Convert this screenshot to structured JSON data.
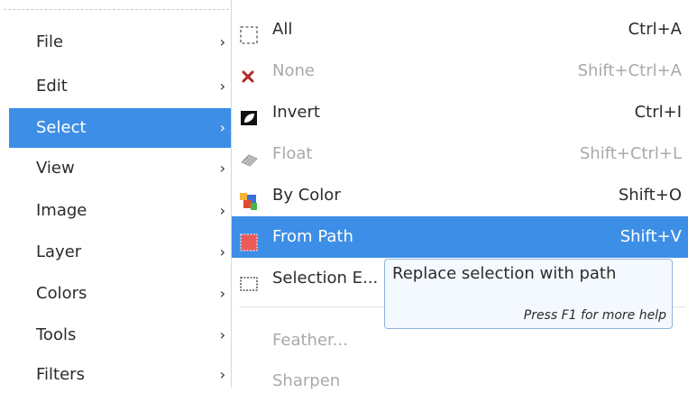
{
  "main_menu": {
    "items": [
      {
        "label": "File",
        "arrow": "›"
      },
      {
        "label": "Edit",
        "arrow": "›"
      },
      {
        "label": "Select",
        "arrow": "›"
      },
      {
        "label": "View",
        "arrow": "›"
      },
      {
        "label": "Image",
        "arrow": "›"
      },
      {
        "label": "Layer",
        "arrow": "›"
      },
      {
        "label": "Colors",
        "arrow": "›"
      },
      {
        "label": "Tools",
        "arrow": "›"
      },
      {
        "label": "Filters",
        "arrow": "›"
      }
    ],
    "active_item": "Select"
  },
  "select_submenu": {
    "items": [
      {
        "label": "All",
        "shortcut": "Ctrl+A",
        "icon": "select-all-icon",
        "enabled": true
      },
      {
        "label": "None",
        "shortcut": "Shift+Ctrl+A",
        "icon": "select-none-icon",
        "enabled": false
      },
      {
        "label": "Invert",
        "shortcut": "Ctrl+I",
        "icon": "invert-selection-icon",
        "enabled": true
      },
      {
        "label": "Float",
        "shortcut": "Shift+Ctrl+L",
        "icon": "float-selection-icon",
        "enabled": false
      },
      {
        "label": "By Color",
        "shortcut": "Shift+O",
        "icon": "select-by-color-icon",
        "enabled": true
      },
      {
        "label": "From Path",
        "shortcut": "Shift+V",
        "icon": "selection-from-path-icon",
        "enabled": true
      },
      {
        "label": "Selection E...",
        "shortcut": "",
        "icon": "selection-editor-icon",
        "enabled": true
      },
      {
        "label": "Feather...",
        "shortcut": "",
        "icon": "",
        "enabled": false
      },
      {
        "label": "Sharpen",
        "shortcut": "",
        "icon": "",
        "enabled": false
      }
    ],
    "highlighted_item": "From Path"
  },
  "tooltip": {
    "text": "Replace selection with path",
    "help": "Press F1 for more help"
  },
  "colors": {
    "highlight": "#3d8ee6",
    "disabled_text": "#a9a9a9",
    "tooltip_bg": "#f4f9ff",
    "tooltip_border": "#8fb4dc"
  }
}
